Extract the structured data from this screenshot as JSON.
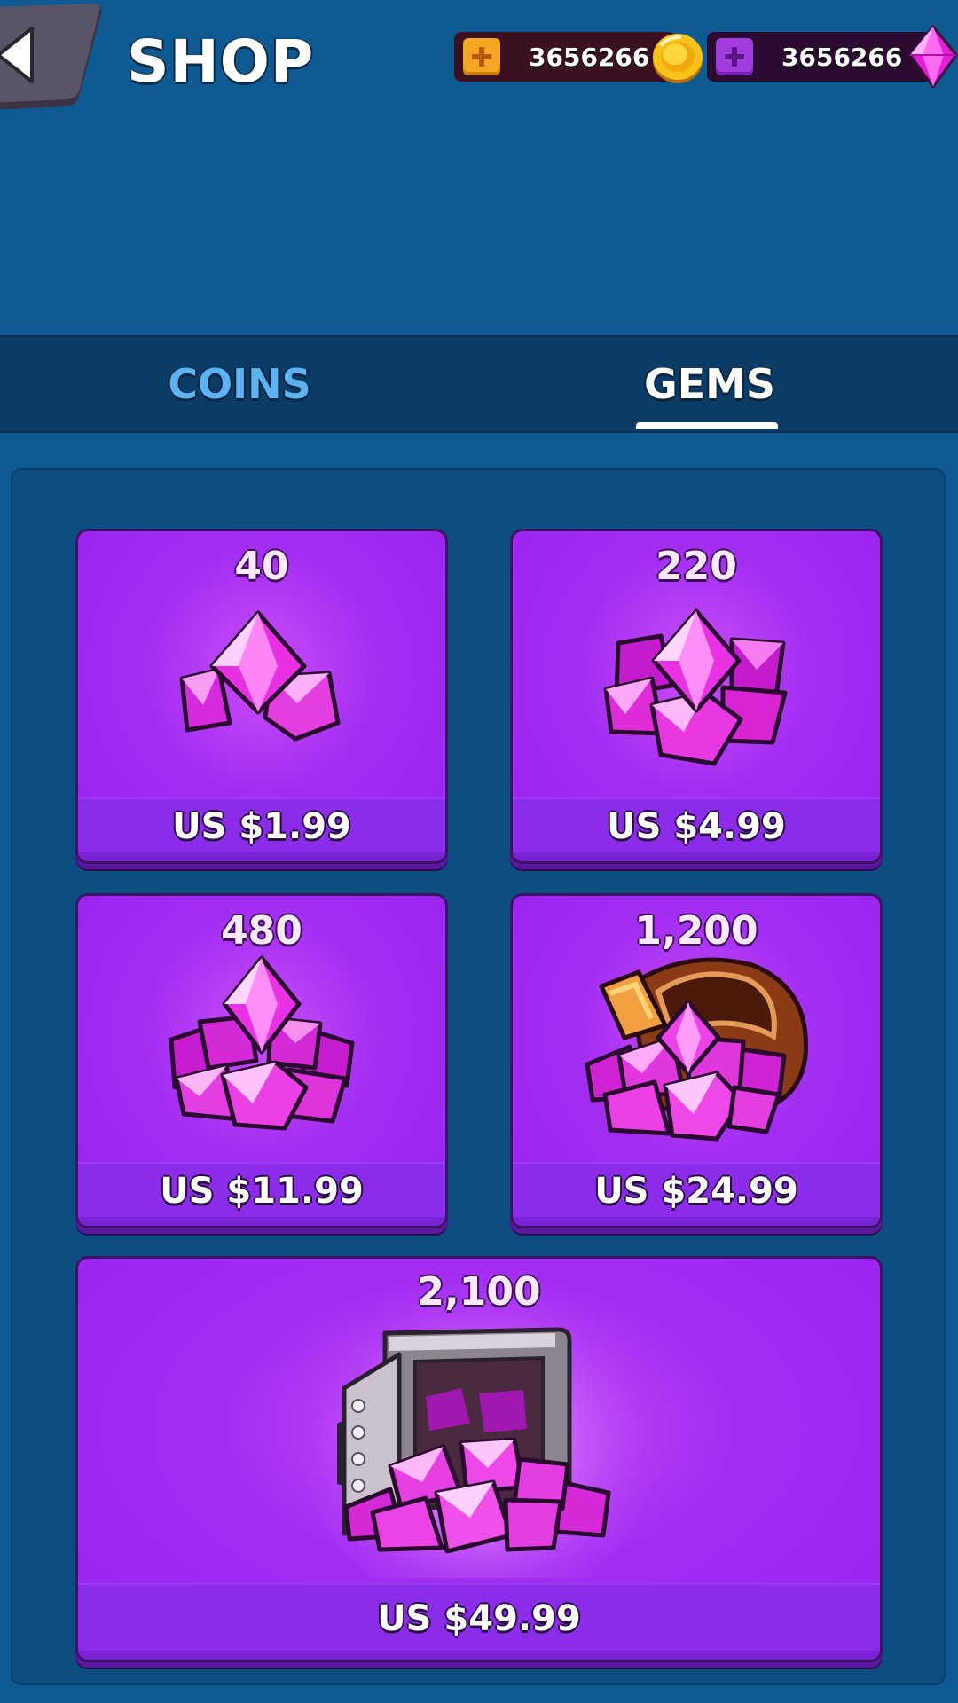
{
  "header": {
    "title": "SHOP",
    "coins": "3656266",
    "gems": "3656266"
  },
  "tabs": [
    {
      "label": "COINS",
      "active": false
    },
    {
      "label": "GEMS",
      "active": true
    }
  ],
  "offers": [
    {
      "amount": "40",
      "price": "US $1.99"
    },
    {
      "amount": "220",
      "price": "US $4.99"
    },
    {
      "amount": "480",
      "price": "US $11.99"
    },
    {
      "amount": "1,200",
      "price": "US $24.99"
    },
    {
      "amount": "2,100",
      "price": "US $49.99"
    }
  ],
  "colors": {
    "background": "#0f5a92",
    "card": "#a32ef2",
    "coin_accent": "#f5a623",
    "gem_accent": "#e23ee8"
  },
  "icons": [
    "back-arrow-icon",
    "coin-icon",
    "gem-icon",
    "plus-icon"
  ]
}
